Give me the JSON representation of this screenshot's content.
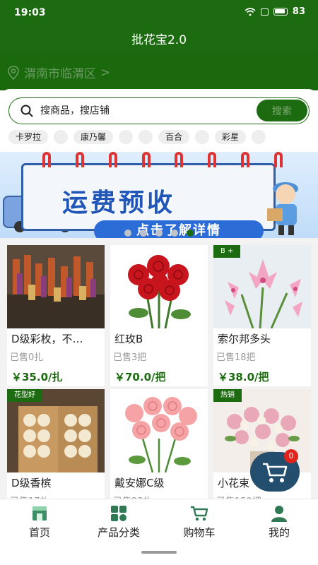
{
  "status_bar": {
    "time": "19:03",
    "battery": "83"
  },
  "header": {
    "title": "批花宝2.0"
  },
  "location": {
    "text": "渭南市临渭区",
    "chevron": ">"
  },
  "search": {
    "placeholder": "搜商品，搜店铺",
    "button_label": "搜索"
  },
  "tags": [
    "卡罗拉",
    "",
    "康乃馨",
    "",
    "",
    "百合",
    "",
    "彩星",
    ""
  ],
  "banner": {
    "title": "运费预收",
    "subtitle": "点击了解详情",
    "slide_count": 5,
    "active_slide": 4
  },
  "products": [
    {
      "name": "D级彩枚，不…",
      "sold": "已售0扎",
      "price": "￥35.0/扎",
      "tag": "",
      "image": "dyed-roses-bundles"
    },
    {
      "name": "红玫B",
      "sold": "已售3把",
      "price": "￥70.0/把",
      "tag": "",
      "image": "red-roses"
    },
    {
      "name": "索尔邦多头",
      "sold": "已售18把",
      "price": "￥38.0/把",
      "tag": "B +",
      "image": "pink-lily"
    },
    {
      "name": "D级香槟",
      "sold": "已售17扎",
      "price": "",
      "tag": "花型好",
      "image": "champagne-roses-box"
    },
    {
      "name": "戴安娜C级",
      "sold": "已售23扎",
      "price": "",
      "tag": "",
      "image": "pink-roses"
    },
    {
      "name": "小花束",
      "sold": "已售159把",
      "price": "",
      "tag": "热销",
      "image": "mixed-bouquet"
    }
  ],
  "cart": {
    "badge_count": "0",
    "icon": "cart-icon"
  },
  "tabbar": {
    "items": [
      {
        "label": "首页",
        "icon": "home-icon"
      },
      {
        "label": "产品分类",
        "icon": "category-icon"
      },
      {
        "label": "购物车",
        "icon": "cart-icon"
      },
      {
        "label": "我的",
        "icon": "user-icon"
      }
    ]
  },
  "colors": {
    "primary": "#1d6b10",
    "price": "#1d6b10",
    "badge": "#e0241b",
    "banner_blue": "#1f56b8"
  }
}
